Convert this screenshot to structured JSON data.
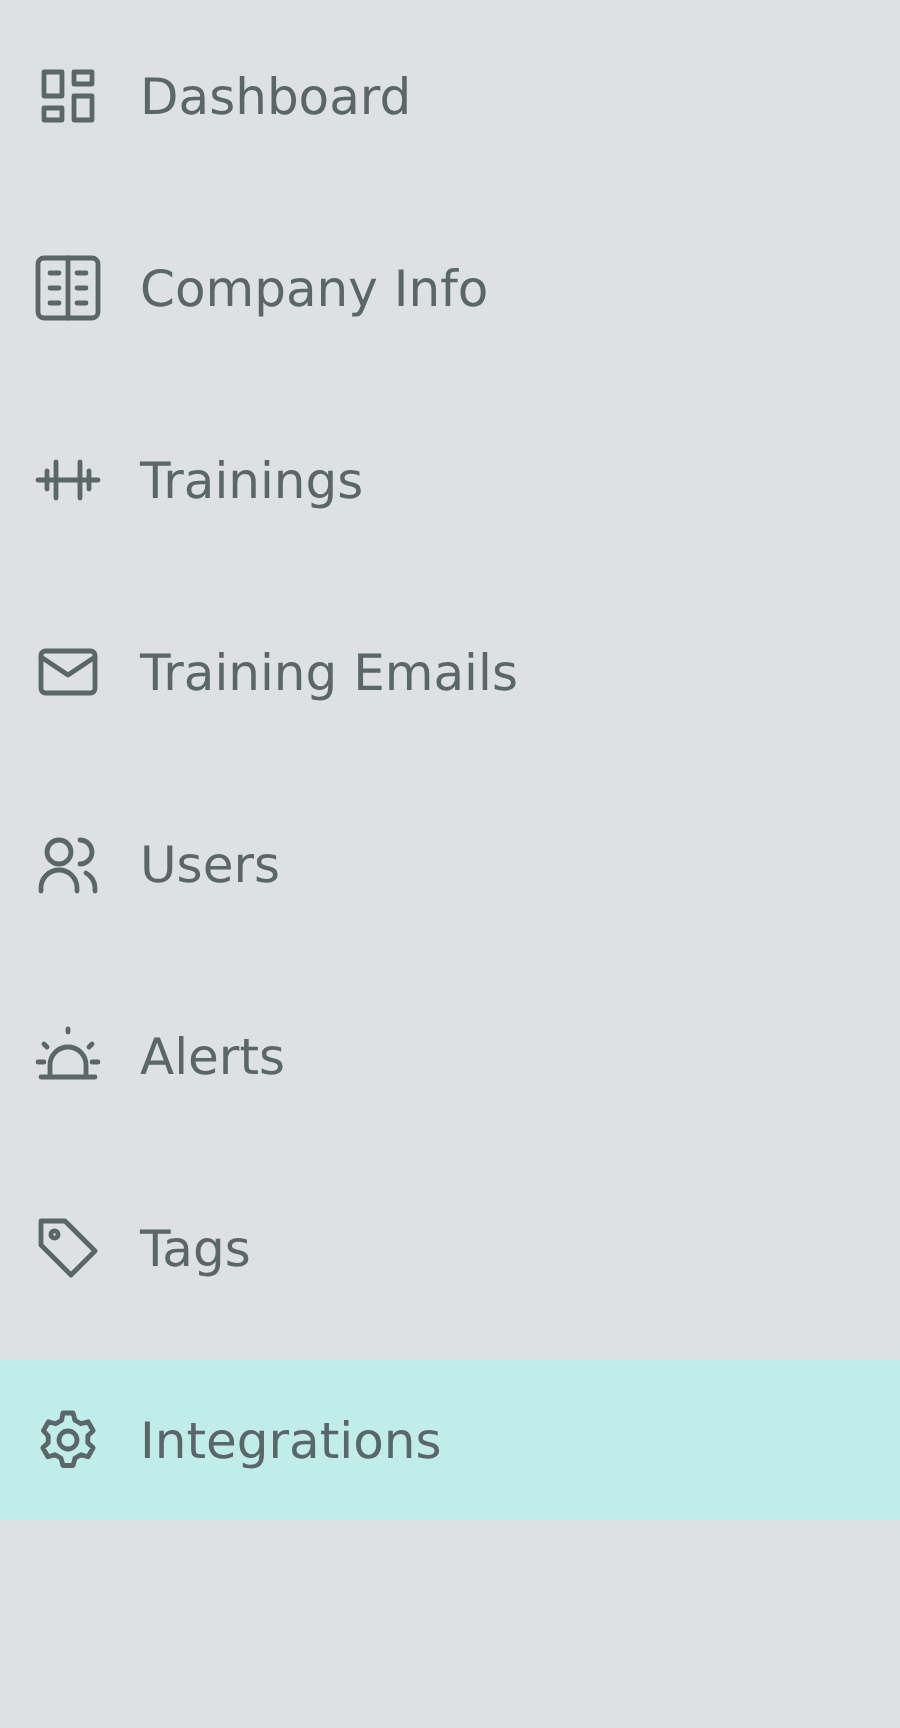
{
  "sidebar": {
    "items": [
      {
        "label": "Dashboard",
        "selected": false
      },
      {
        "label": "Company Info",
        "selected": false
      },
      {
        "label": "Trainings",
        "selected": false
      },
      {
        "label": "Training Emails",
        "selected": false
      },
      {
        "label": "Users",
        "selected": false
      },
      {
        "label": "Alerts",
        "selected": false
      },
      {
        "label": "Tags",
        "selected": false
      },
      {
        "label": "Integrations",
        "selected": true
      }
    ]
  }
}
